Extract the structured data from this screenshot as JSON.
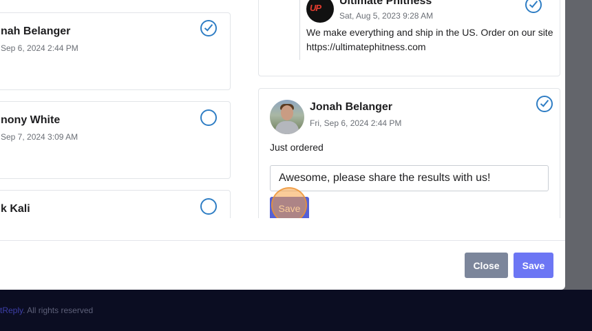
{
  "left_comments": [
    {
      "name": "nah Belanger",
      "date": "Sep 6, 2024 2:44 PM",
      "checked": true
    },
    {
      "name": "nony White",
      "date": "Sep 7, 2024 3:09 AM",
      "checked": false
    },
    {
      "name": "k Kali",
      "checked": false
    }
  ],
  "thread": {
    "reply": {
      "author": "Ultimate Phitness",
      "avatar_text": "UP",
      "date": "Sat, Aug 5, 2023 9:28 AM",
      "text": "We make everything and ship in the US. Order on our site https://ultimatephitness.com",
      "checked": true
    },
    "comment": {
      "author": "Jonah Belanger",
      "date": "Fri, Sep 6, 2024 2:44 PM",
      "text": "Just ordered",
      "checked": true,
      "reply_value": "Awesome, please share the results with us!",
      "save_label": "Save"
    }
  },
  "dialog": {
    "close_label": "Close",
    "save_label": "Save"
  },
  "footer": {
    "brand": "tReply",
    "rights": ". All rights reserved"
  },
  "colors": {
    "accent": "#6c76f4",
    "check": "#2e7dc4",
    "footer_bg": "#0b0d22"
  }
}
